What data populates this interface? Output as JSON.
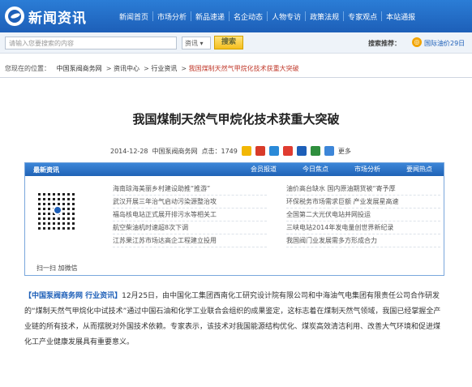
{
  "header": {
    "site_name": "新闻资讯",
    "nav": [
      "新闻首页",
      "市场分析",
      "新品速递",
      "名企动态",
      "人物专访",
      "政策法规",
      "专家观点",
      "本站通报"
    ]
  },
  "search": {
    "placeholder": "请输入您要搜索的内容",
    "type": "资讯 ▾",
    "button": "搜索",
    "recommend_label": "搜索推荐：",
    "recommend_link": "国际油价29日"
  },
  "breadcrumb": {
    "prefix": "您现在的位置：",
    "items": [
      "中国泵阀商务网",
      "资讯中心",
      "行业资讯"
    ],
    "current": "我国煤制天然气甲烷化技术获重大突破"
  },
  "article": {
    "title": "我国煤制天然气甲烷化技术获重大突破",
    "date": "2014-12-28",
    "source": "中国泵阀商务网",
    "clicks_label": "点击：",
    "clicks": "1749",
    "more": "更多",
    "body_source": "【中国泵阀商务网  行业资讯】",
    "body": "12月25日，由中国化工集团西南化工研究设计院有限公司和中海油气电集团有限责任公司合作研发的“煤制天然气甲烷化中试技术”通过中国石油和化学工业联合会组织的成果鉴定，这标志着在煤制天然气领域，我国已经掌握全产业链的所有技术，从而摆脱对外国技术依赖。专家表示，该技术对我国能源结构优化、煤炭高效清洁利用、改善大气环境和促进煤化工产业健康发展具有重要意义。"
  },
  "newsbox": {
    "label": "最新资讯",
    "tabs": [
      "会员报道",
      "今日焦点",
      "市场分析",
      "要闻热点"
    ],
    "qr_caption": "扫一扫  加微信",
    "left": [
      "海南琼海美丽乡村建设助推“推游”",
      "武汉开展三年治气启动污染源整治攻",
      "福岛核电站正式展开排污水等相关工",
      "航空柴油机时速超8次下调",
      "江苏果江苏市场达高企工程建立投用"
    ],
    "right": [
      "油价高台缺水 国内原油期货被“寄予厚",
      "环保税务市场需求巨额 产业发展星高速",
      "全国第二大光伏电站并网投运",
      "三峡电站2014年发电量创世界新纪录",
      "我国阀门业发展需多方形成合力"
    ]
  },
  "colors": {
    "nav_bg": "#1d5fb8",
    "accent": "#c0392b",
    "button": "#f5bf1e"
  }
}
